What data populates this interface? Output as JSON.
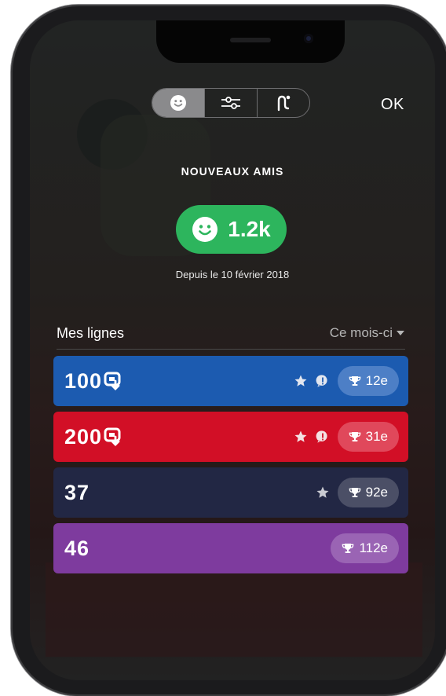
{
  "toolbar": {
    "segments": [
      "smiley-icon",
      "sliders-icon",
      "route-icon"
    ],
    "selected": 0,
    "ok_label": "OK"
  },
  "friends": {
    "title": "NOUVEAUX AMIS",
    "count": "1.2k",
    "since": "Depuis le 10 février 2018"
  },
  "lines": {
    "header": "Mes lignes",
    "period": "Ce mois-ci",
    "items": [
      {
        "number": "100",
        "color": "#1c5bb0",
        "rank": "12e",
        "star": true,
        "alert": true,
        "connection_icon": true
      },
      {
        "number": "200",
        "color": "#d20f26",
        "rank": "31e",
        "star": true,
        "alert": true,
        "connection_icon": true
      },
      {
        "number": "37",
        "color": "#222744",
        "rank": "92e",
        "star": true,
        "alert": false,
        "connection_icon": false
      },
      {
        "number": "46",
        "color": "#7e3b9e",
        "rank": "112e",
        "star": false,
        "alert": false,
        "connection_icon": false
      }
    ]
  }
}
